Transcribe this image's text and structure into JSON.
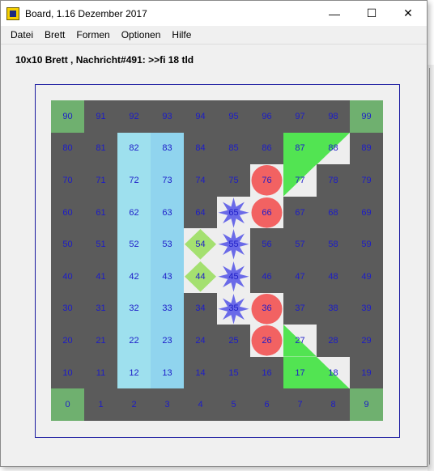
{
  "window": {
    "title": "Board, 1.16 Dezember 2017",
    "minimize_glyph": "—",
    "maximize_glyph": "☐",
    "close_glyph": "✕"
  },
  "menu": [
    "Datei",
    "Brett",
    "Formen",
    "Optionen",
    "Hilfe"
  ],
  "status_message": "10x10 Brett , Nachricht#491: >>fi 18 tld",
  "colors": {
    "board_background": "#5b5b5b",
    "cell_number": "#1c1cc8",
    "corner_green": "#6fb06f",
    "light_blue": "#9ee0ee",
    "mid_blue": "#90d4ee",
    "white_cell": "#eeeeee",
    "red_circle": "#f26262",
    "blue_star": "#6a6ae8",
    "green_diamond": "#a4e070",
    "bright_green": "#52e452",
    "frame_border": "#1a1aa0"
  },
  "board": {
    "size": 10,
    "numbers": [
      [
        90,
        91,
        92,
        93,
        94,
        95,
        96,
        97,
        98,
        99
      ],
      [
        80,
        81,
        82,
        83,
        84,
        85,
        86,
        87,
        88,
        89
      ],
      [
        70,
        71,
        72,
        73,
        74,
        75,
        76,
        77,
        78,
        79
      ],
      [
        60,
        61,
        62,
        63,
        64,
        65,
        66,
        67,
        68,
        69
      ],
      [
        50,
        51,
        52,
        53,
        54,
        55,
        56,
        57,
        58,
        59
      ],
      [
        40,
        41,
        42,
        43,
        44,
        45,
        46,
        47,
        48,
        49
      ],
      [
        30,
        31,
        32,
        33,
        34,
        35,
        36,
        37,
        38,
        39
      ],
      [
        20,
        21,
        22,
        23,
        24,
        25,
        26,
        27,
        28,
        29
      ],
      [
        10,
        11,
        12,
        13,
        14,
        15,
        16,
        17,
        18,
        19
      ],
      [
        0,
        1,
        2,
        3,
        4,
        5,
        6,
        7,
        8,
        9
      ]
    ],
    "cell_styles": [
      {
        "cells": [
          90,
          99,
          0,
          9
        ],
        "background": "#6fb06f"
      },
      {
        "cells": [
          82,
          72,
          62,
          52,
          42,
          32,
          22,
          12
        ],
        "background": "#9ee0ee"
      },
      {
        "cells": [
          83,
          73,
          63,
          53,
          43,
          33,
          23,
          13
        ],
        "background": "#90d4ee"
      },
      {
        "cells": [
          65,
          55,
          45,
          35,
          54,
          44,
          76,
          66,
          36,
          26,
          88,
          77,
          27,
          18
        ],
        "background": "#eeeeee"
      }
    ],
    "shapes": [
      {
        "cell": 76,
        "shape": "circle",
        "color": "#f26262"
      },
      {
        "cell": 66,
        "shape": "circle",
        "color": "#f26262"
      },
      {
        "cell": 36,
        "shape": "circle",
        "color": "#f26262"
      },
      {
        "cell": 26,
        "shape": "circle",
        "color": "#f26262"
      },
      {
        "cell": 65,
        "shape": "star",
        "color": "#6a6ae8"
      },
      {
        "cell": 55,
        "shape": "star",
        "color": "#6a6ae8"
      },
      {
        "cell": 45,
        "shape": "star",
        "color": "#6a6ae8"
      },
      {
        "cell": 35,
        "shape": "star",
        "color": "#6a6ae8"
      },
      {
        "cell": 54,
        "shape": "diamond",
        "color": "#a4e070"
      },
      {
        "cell": 44,
        "shape": "diamond",
        "color": "#a4e070"
      },
      {
        "cell": 87,
        "shape": "triangle-fill",
        "color": "#52e452"
      },
      {
        "cell": 88,
        "shape": "triangle-top-left",
        "color": "#52e452"
      },
      {
        "cell": 77,
        "shape": "triangle-top-left",
        "color": "#52e452"
      },
      {
        "cell": 17,
        "shape": "triangle-fill",
        "color": "#52e452"
      },
      {
        "cell": 27,
        "shape": "triangle-bottom-left",
        "color": "#52e452"
      },
      {
        "cell": 18,
        "shape": "triangle-bottom-left",
        "color": "#52e452"
      }
    ]
  }
}
